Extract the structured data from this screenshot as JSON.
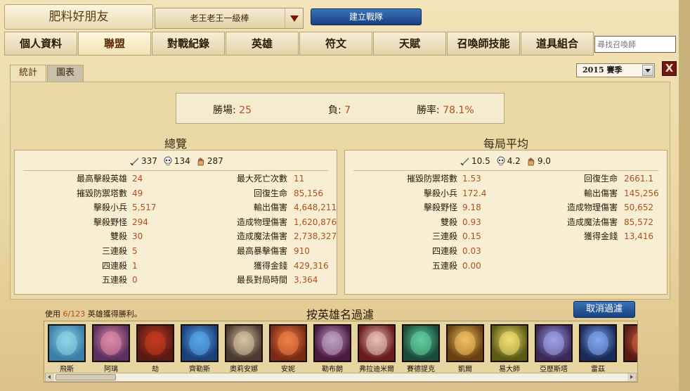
{
  "header": {
    "player_name": "肥料好朋友",
    "team_select": "老王老王一級棒",
    "create_team": "建立戰隊"
  },
  "nav": {
    "tabs": [
      {
        "label": "個人資料"
      },
      {
        "label": "聯盟"
      },
      {
        "label": "對戰紀錄"
      },
      {
        "label": "英雄"
      },
      {
        "label": "符文"
      },
      {
        "label": "天賦"
      },
      {
        "label": "召喚師技能"
      },
      {
        "label": "道具組合"
      }
    ],
    "active_index": 1,
    "search_placeholder": "尋找召喚師"
  },
  "subtabs": {
    "stats": "統計",
    "chart": "圖表"
  },
  "season": "2015 賽季",
  "close_label": "X",
  "summary": {
    "wins_label": "勝場:",
    "wins": "25",
    "losses_label": "負:",
    "losses": "7",
    "winrate_label": "勝率:",
    "winrate": "78.1%"
  },
  "overview": {
    "title": "總覽",
    "kills": "337",
    "deaths": "134",
    "assists": "287",
    "left": [
      {
        "k": "最高擊殺英雄",
        "v": "24"
      },
      {
        "k": "摧毀防禦塔數",
        "v": "49"
      },
      {
        "k": "擊殺小兵",
        "v": "5,517"
      },
      {
        "k": "擊殺野怪",
        "v": "294"
      },
      {
        "k": "雙殺",
        "v": "30"
      },
      {
        "k": "三連殺",
        "v": "5"
      },
      {
        "k": "四連殺",
        "v": "1"
      },
      {
        "k": "五連殺",
        "v": "0"
      }
    ],
    "right": [
      {
        "k": "最大死亡次數",
        "v": "11"
      },
      {
        "k": "回復生命",
        "v": "85,156"
      },
      {
        "k": "輸出傷害",
        "v": "4,648,211"
      },
      {
        "k": "造成物理傷害",
        "v": "1,620,876"
      },
      {
        "k": "造成魔法傷害",
        "v": "2,738,327"
      },
      {
        "k": "最高暴擊傷害",
        "v": "910"
      },
      {
        "k": "獲得金錢",
        "v": "429,316"
      },
      {
        "k": "最長對局時間",
        "v": "3,364"
      }
    ]
  },
  "per_game": {
    "title": "每局平均",
    "kills": "10.5",
    "deaths": "4.2",
    "assists": "9.0",
    "left": [
      {
        "k": "摧毀防禦塔數",
        "v": "1.53"
      },
      {
        "k": "擊殺小兵",
        "v": "172.4"
      },
      {
        "k": "擊殺野怪",
        "v": "9.18"
      },
      {
        "k": "雙殺",
        "v": "0.93"
      },
      {
        "k": "三連殺",
        "v": "0.15"
      },
      {
        "k": "四連殺",
        "v": "0.03"
      },
      {
        "k": "五連殺",
        "v": "0.00"
      }
    ],
    "right": [
      {
        "k": "回復生命",
        "v": "2661.1"
      },
      {
        "k": "輸出傷害",
        "v": "145,256"
      },
      {
        "k": "造成物理傷害",
        "v": "50,652"
      },
      {
        "k": "造成魔法傷害",
        "v": "85,572"
      },
      {
        "k": "獲得金錢",
        "v": "13,416"
      }
    ]
  },
  "champion_filter": {
    "win_prefix": "使用",
    "win_count": "6/123",
    "win_suffix": "英雄獲得勝利。",
    "title": "按英雄名過濾",
    "cancel": "取消過濾",
    "champions": [
      {
        "name": "飛斯",
        "color": "#3a7fa8",
        "accent": "#8fd4e6"
      },
      {
        "name": "阿璃",
        "color": "#5a3060",
        "accent": "#e08aa8"
      },
      {
        "name": "劫",
        "color": "#5a1a14",
        "accent": "#c43a1e"
      },
      {
        "name": "齊勒斯",
        "color": "#1c3f7a",
        "accent": "#58a8e8"
      },
      {
        "name": "奧莉安娜",
        "color": "#4a3a30",
        "accent": "#d8c2a0"
      },
      {
        "name": "安妮",
        "color": "#7a2a14",
        "accent": "#f08048"
      },
      {
        "name": "勒布朗",
        "color": "#4a1a40",
        "accent": "#c0a0c8"
      },
      {
        "name": "弗拉迪米爾",
        "color": "#6a1a1a",
        "accent": "#e8c0b0"
      },
      {
        "name": "賽德提克",
        "color": "#1a4a3a",
        "accent": "#60d0a0"
      },
      {
        "name": "凱爾",
        "color": "#6a4010",
        "accent": "#f0c060"
      },
      {
        "name": "易大師",
        "color": "#5a5a14",
        "accent": "#f0e070"
      },
      {
        "name": "亞歷斯塔",
        "color": "#3a2a5a",
        "accent": "#a0a0e8"
      },
      {
        "name": "雷茲",
        "color": "#1a2a5a",
        "accent": "#80a8f0"
      },
      {
        "name": "",
        "color": "#5a1a14",
        "accent": "#c85a3a"
      }
    ]
  }
}
